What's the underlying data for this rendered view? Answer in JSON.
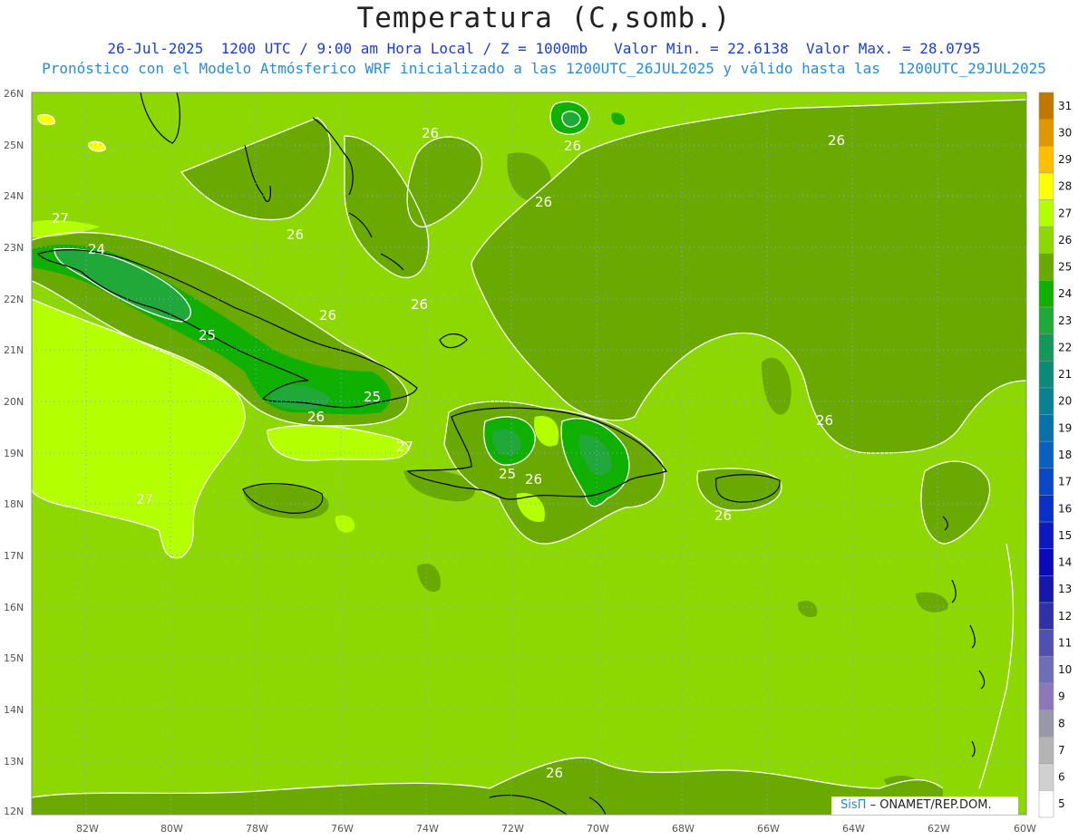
{
  "header": {
    "title": "Temperatura (C,somb.)",
    "line1": "26-Jul-2025  1200 UTC / 9:00 am Hora Local / Z = 1000mb   Valor Min. = 22.6138  Valor Max. = 28.0795",
    "line2": "Pronóstico con el Modelo Atmósferico WRF inicializado a las 1200UTC_26JUL2025 y válido hasta las  1200UTC_29JUL2025"
  },
  "axes": {
    "lat_labels": [
      "26N",
      "25N",
      "24N",
      "23N",
      "22N",
      "21N",
      "20N",
      "19N",
      "18N",
      "17N",
      "16N",
      "15N",
      "14N",
      "13N",
      "12N"
    ],
    "lon_labels": [
      "82W",
      "80W",
      "78W",
      "76W",
      "74W",
      "72W",
      "70W",
      "68W",
      "66W",
      "64W",
      "62W",
      "60W"
    ]
  },
  "contour_labels": [
    "26",
    "26",
    "26",
    "26",
    "26",
    "26",
    "26",
    "26",
    "26",
    "26",
    "27",
    "27",
    "27",
    "24",
    "25",
    "25",
    "25",
    "26",
    "26"
  ],
  "colorbar": {
    "labels": [
      "31",
      "30",
      "29",
      "28",
      "27",
      "26",
      "25",
      "24",
      "23",
      "22",
      "21",
      "20",
      "19",
      "18",
      "17",
      "16",
      "15",
      "14",
      "13",
      "12",
      "11",
      "10",
      "9",
      "8",
      "7",
      "6",
      "5"
    ],
    "colors": [
      "#c07800",
      "#e09800",
      "#ffbe00",
      "#ffff00",
      "#b4ff00",
      "#8cd800",
      "#6aaa00",
      "#10b000",
      "#20a838",
      "#14985a",
      "#0c8a78",
      "#0a8090",
      "#0a70a8",
      "#0a60c0",
      "#0a48c8",
      "#0a30c8",
      "#0a1ac0",
      "#0a0ab8",
      "#1818a8",
      "#3030a8",
      "#5050b0",
      "#6e6eb8",
      "#8c78b8",
      "#9898a8",
      "#b4b4b4",
      "#d0d0d0",
      "#ffffff"
    ]
  },
  "credit": {
    "brand": "SisΠ",
    "text": "– ONAMET/REP.DOM."
  }
}
